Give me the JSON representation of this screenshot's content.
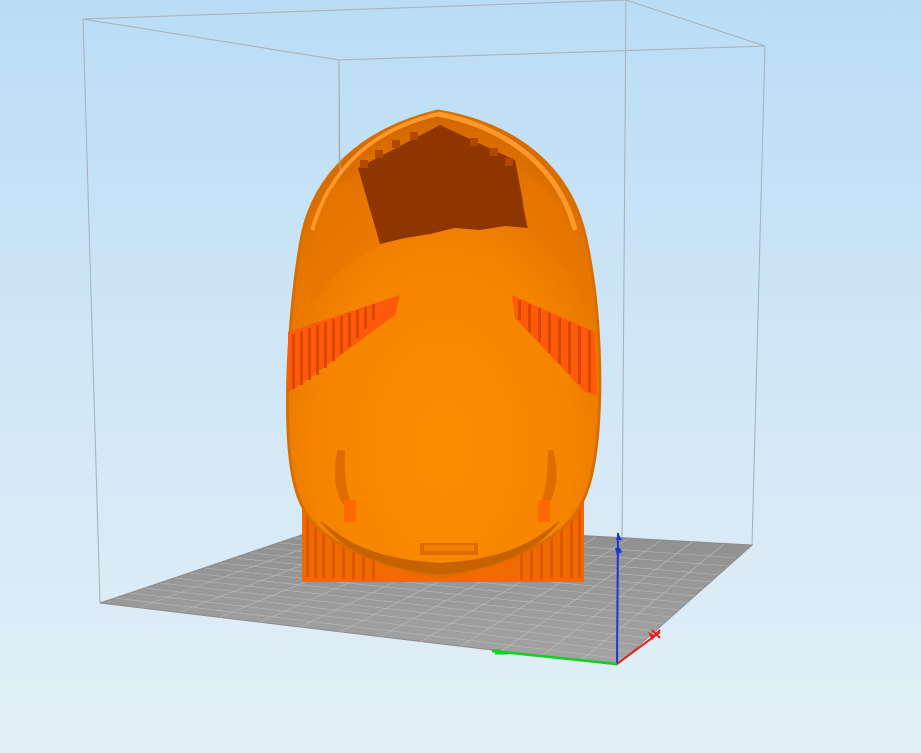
{
  "app": {
    "view": "3d-print-preview",
    "background_top": "#b9ddf6",
    "background_bottom": "#e3eff6"
  },
  "colors": {
    "model_main": "#ff8a00",
    "model_shade": "#e57300",
    "model_dark": "#8f3500",
    "support": "#ff5a0a",
    "bed": "#9b9b9b",
    "bed_grid": "#b3b3b3",
    "volume_lines": "#a9aeb3",
    "axis_x": "#e02020",
    "axis_y": "#10d020",
    "axis_z": "#1a35e0"
  },
  "scene": {
    "objects": [
      "build-volume",
      "print-bed",
      "model",
      "support-structures",
      "axis-gizmo"
    ],
    "icons": [
      "axis-x-icon",
      "axis-y-icon",
      "axis-z-icon"
    ]
  }
}
